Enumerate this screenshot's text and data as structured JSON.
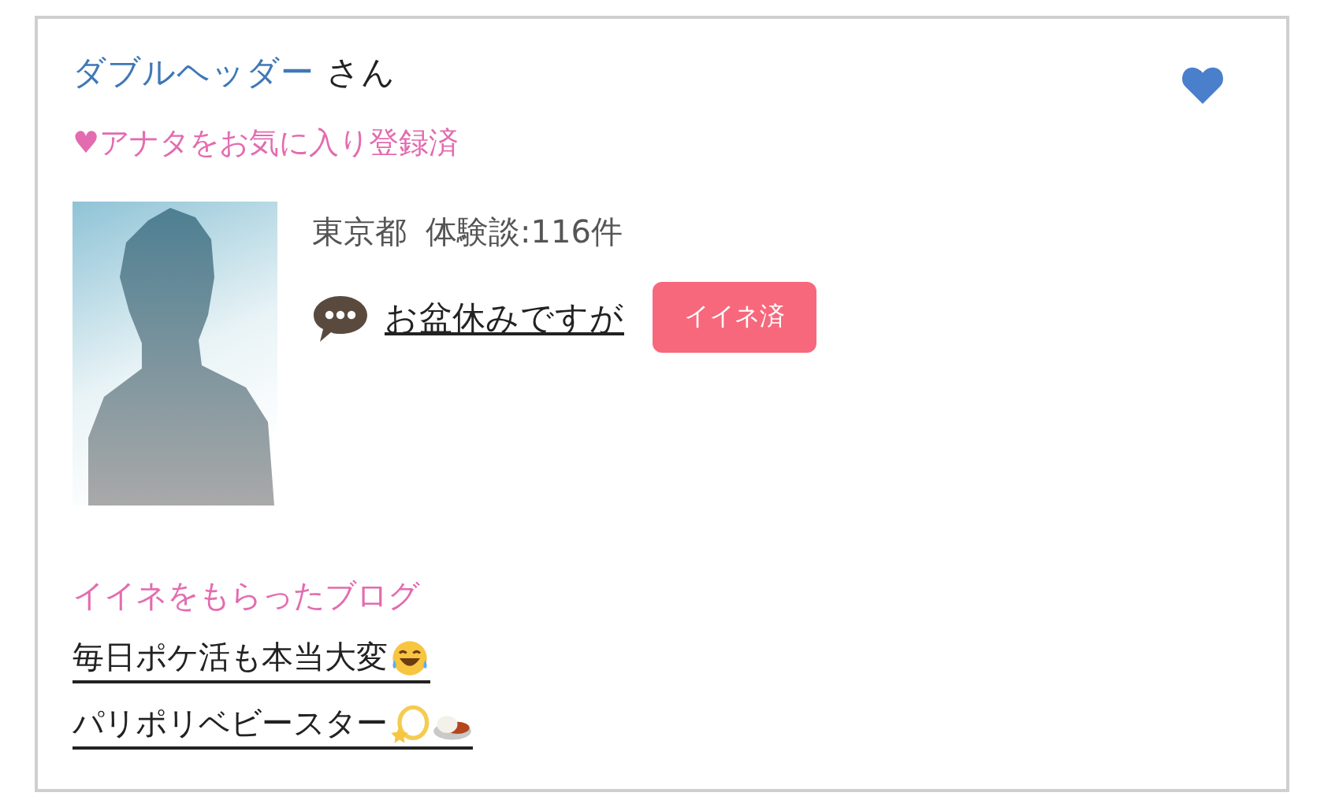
{
  "user": {
    "name": "ダブルヘッダー",
    "honorific": "さん",
    "favorited": true
  },
  "favorite_status": "♥アナタをお気に入り登録済",
  "profile": {
    "location": "東京都",
    "reviews": "体験談:116件"
  },
  "comment": {
    "link": "お盆休みですが",
    "button": "イイネ済"
  },
  "liked_blogs": {
    "title": "イイネをもらったブログ",
    "items": [
      {
        "title": "毎日ポケ活も本当大変",
        "icons": [
          {
            "kind": "laughing"
          }
        ]
      },
      {
        "title": "パリポリベビースター",
        "icons": [
          {
            "kind": "dizzy"
          },
          {
            "kind": "curry"
          }
        ]
      }
    ]
  }
}
